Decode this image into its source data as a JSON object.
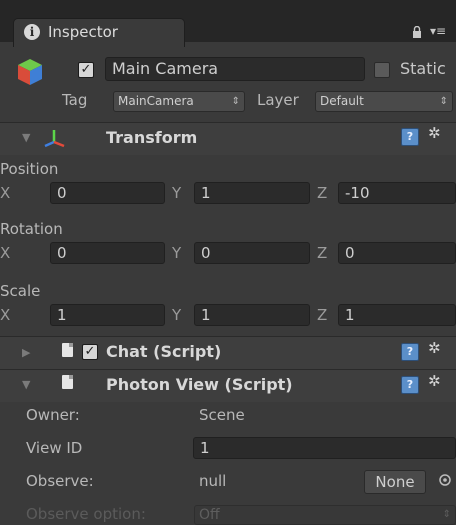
{
  "tab": {
    "title": "Inspector"
  },
  "header": {
    "object_name": "Main Camera",
    "active": true,
    "static_label": "Static",
    "static_checked": false,
    "tag_label": "Tag",
    "tag_value": "MainCamera",
    "layer_label": "Layer",
    "layer_value": "Default"
  },
  "transform": {
    "title": "Transform",
    "position_label": "Position",
    "rotation_label": "Rotation",
    "scale_label": "Scale",
    "axes": [
      "X",
      "Y",
      "Z"
    ],
    "position": [
      "0",
      "1",
      "-10"
    ],
    "rotation": [
      "0",
      "0",
      "0"
    ],
    "scale": [
      "1",
      "1",
      "1"
    ]
  },
  "chat": {
    "title": "Chat (Script)",
    "enabled": true
  },
  "photon": {
    "title": "Photon View (Script)",
    "owner_label": "Owner:",
    "owner_value": "Scene",
    "viewid_label": "View ID",
    "viewid_value": "1",
    "observe_label": "Observe:",
    "observe_value": "null",
    "observe_button": "None",
    "observe_option_label": "Observe option:",
    "observe_option_value": "Off"
  },
  "icons": {
    "info": "i",
    "lock": "🔒",
    "menu": "▾≡",
    "gear": "✲",
    "help": "?"
  },
  "colors": {
    "background": "#3a3a3a",
    "field": "#2b2b2b",
    "help_icon": "#5b8fc9"
  }
}
